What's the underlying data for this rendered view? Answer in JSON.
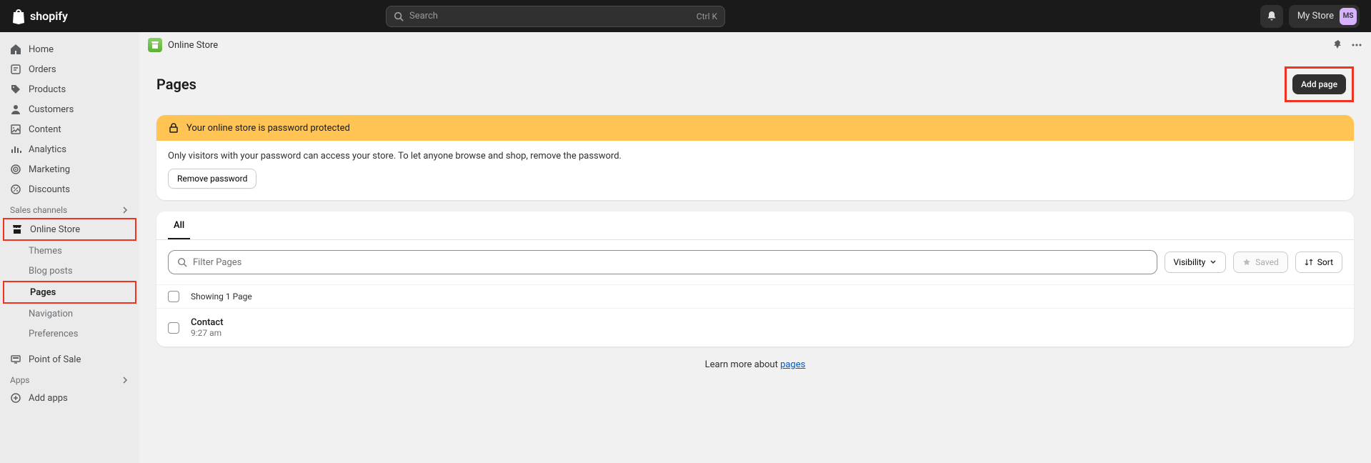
{
  "topbar": {
    "logo_text": "shopify",
    "search_placeholder": "Search",
    "search_shortcut": "Ctrl K",
    "store_name": "My Store",
    "store_initials": "MS"
  },
  "sidebar": {
    "primary": [
      {
        "label": "Home"
      },
      {
        "label": "Orders"
      },
      {
        "label": "Products"
      },
      {
        "label": "Customers"
      },
      {
        "label": "Content"
      },
      {
        "label": "Analytics"
      },
      {
        "label": "Marketing"
      },
      {
        "label": "Discounts"
      }
    ],
    "sales_channels_header": "Sales channels",
    "online_store": "Online Store",
    "online_store_sub": [
      {
        "label": "Themes"
      },
      {
        "label": "Blog posts"
      },
      {
        "label": "Pages"
      },
      {
        "label": "Navigation"
      },
      {
        "label": "Preferences"
      }
    ],
    "point_of_sale": "Point of Sale",
    "apps_header": "Apps",
    "add_apps": "Add apps"
  },
  "breadcrumb": {
    "label": "Online Store"
  },
  "page": {
    "title": "Pages",
    "add_page_label": "Add page"
  },
  "banner": {
    "headline": "Your online store is password protected",
    "body": "Only visitors with your password can access your store. To let anyone browse and shop, remove the password.",
    "remove_label": "Remove password"
  },
  "table": {
    "tab_all": "All",
    "filter_placeholder": "Filter Pages",
    "visibility_label": "Visibility",
    "saved_label": "Saved",
    "sort_label": "Sort",
    "showing": "Showing 1 Page",
    "rows": [
      {
        "title": "Contact",
        "time": "9:27 am"
      }
    ]
  },
  "footer": {
    "learn_prefix": "Learn more about ",
    "learn_link": "pages"
  }
}
